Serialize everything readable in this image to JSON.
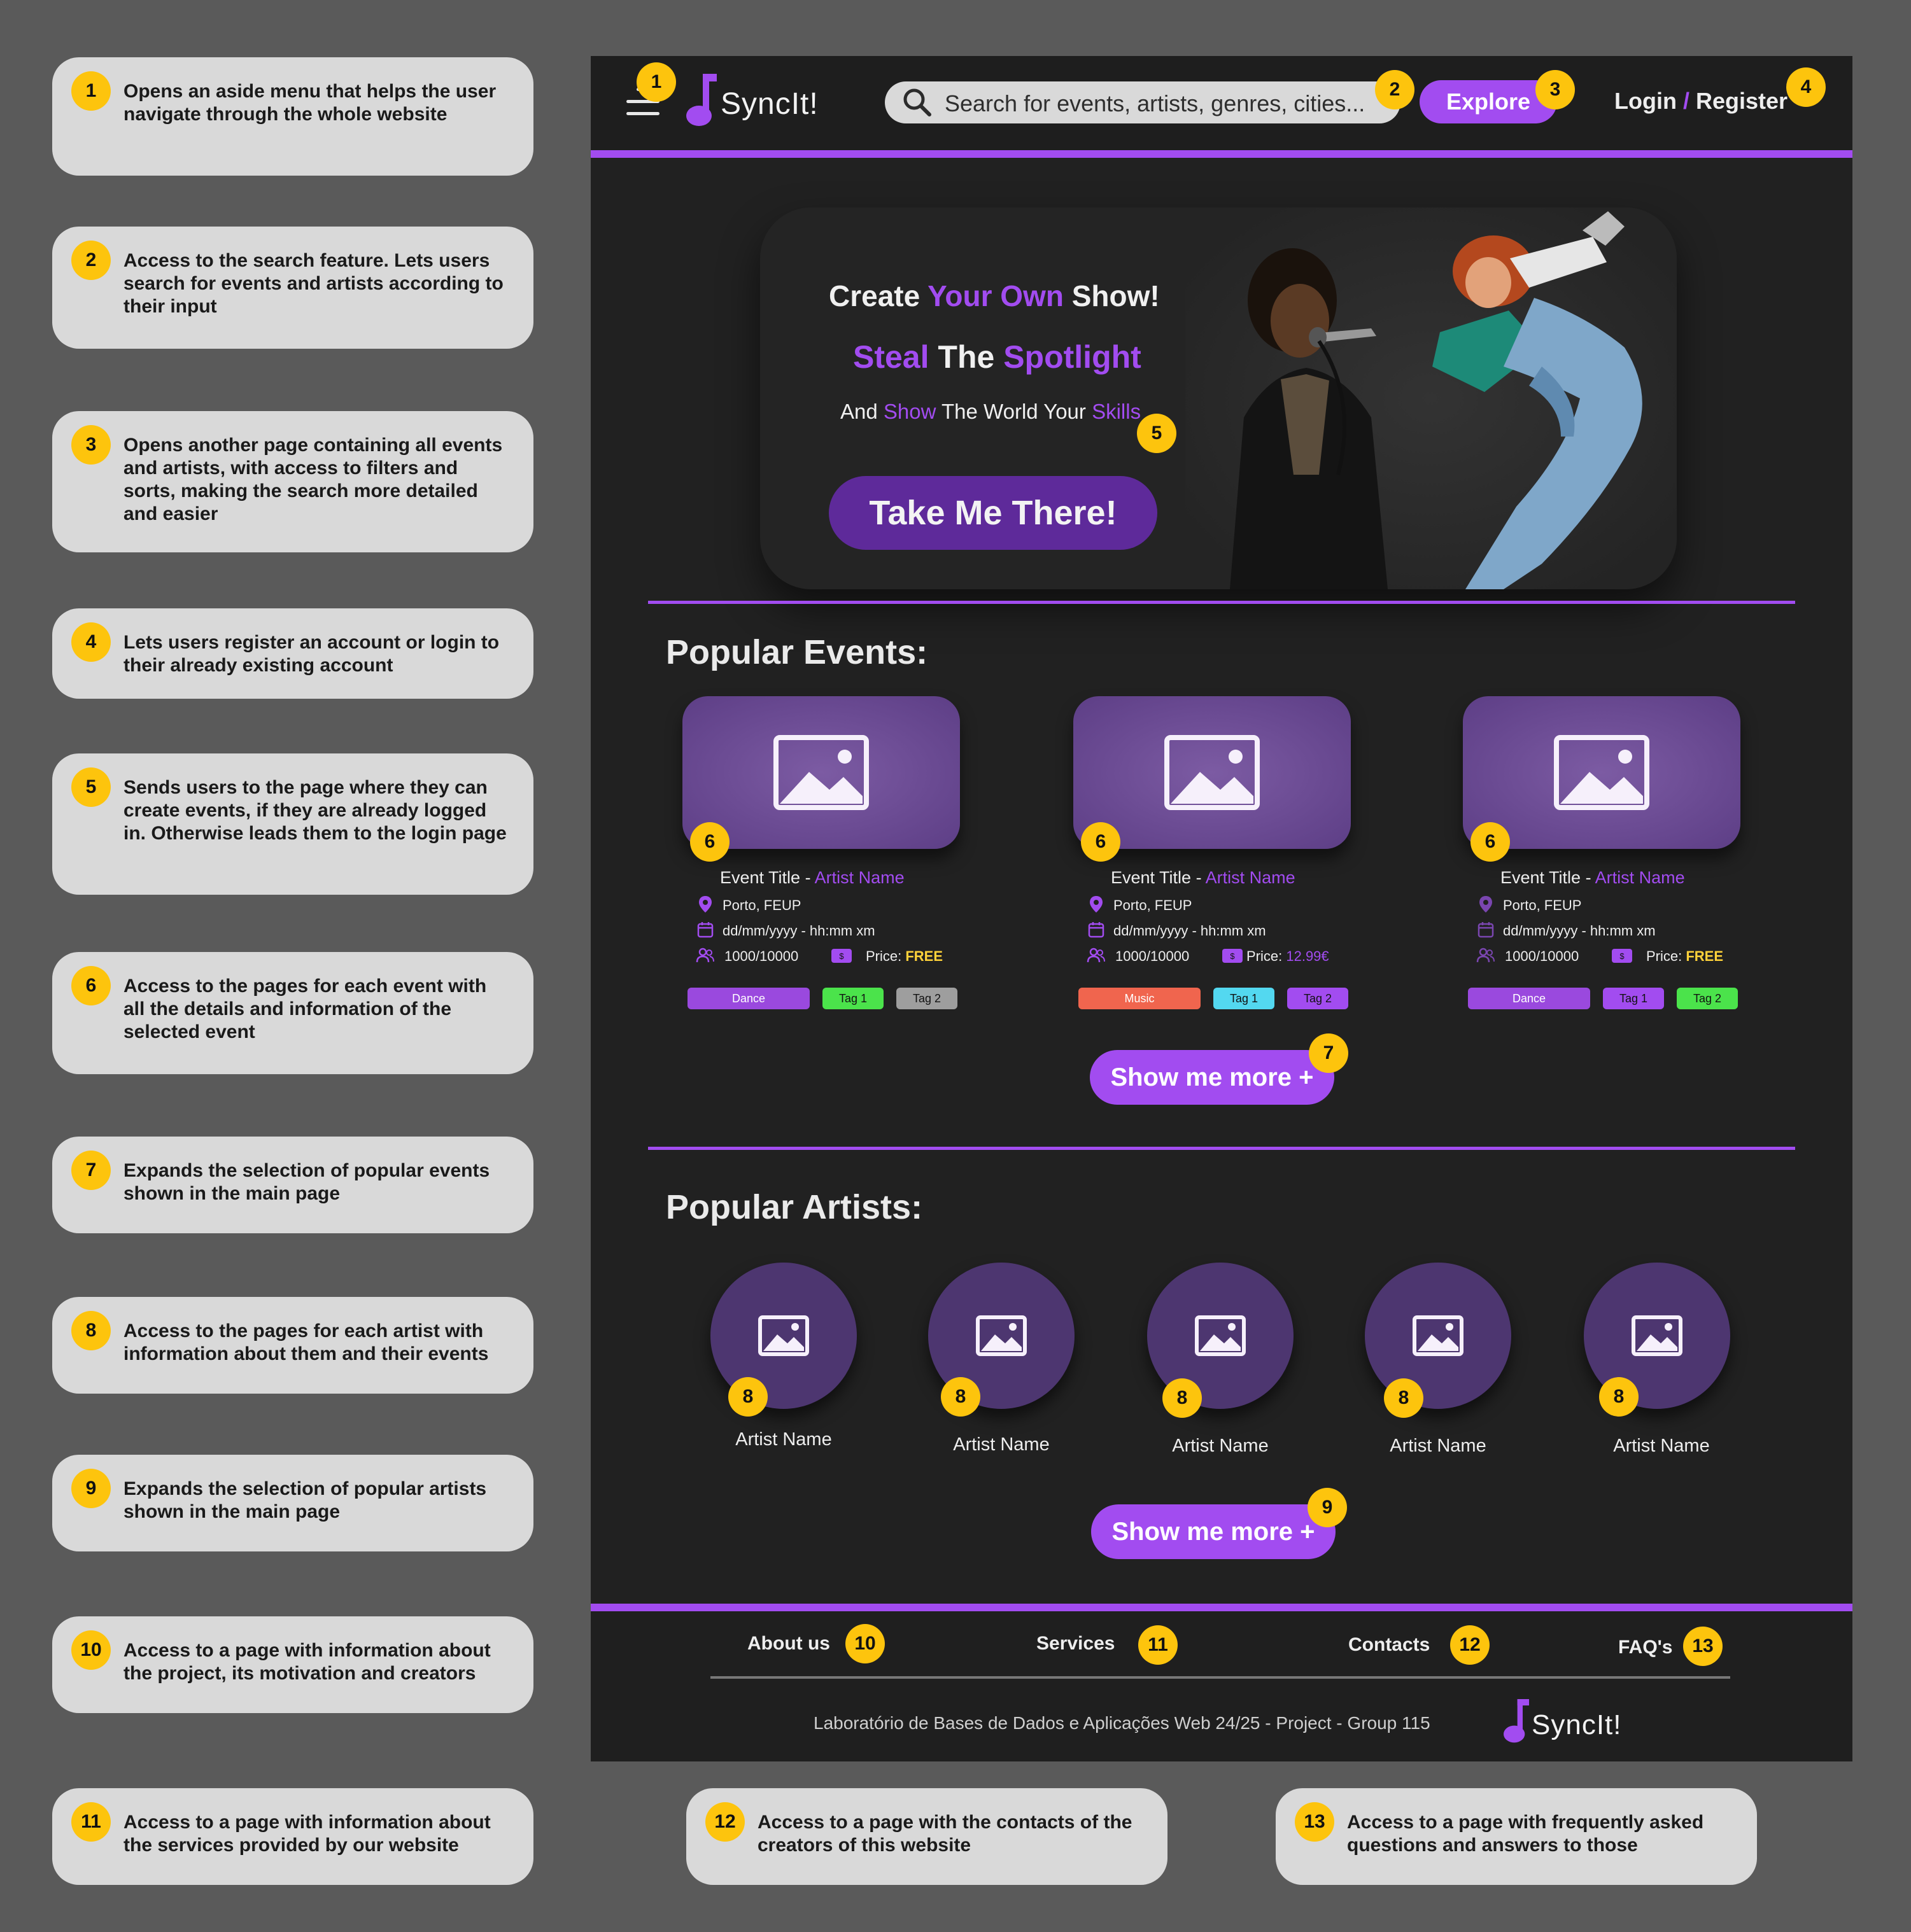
{
  "annotations": [
    {
      "n": "1",
      "text": "Opens an aside menu that helps the user navigate through the whole website"
    },
    {
      "n": "2",
      "text": "Access to the search feature.  Lets users search for events and artists according to their input"
    },
    {
      "n": "3",
      "text": "Opens another page containing all events and artists, with access to filters and sorts, making the search more detailed and easier"
    },
    {
      "n": "4",
      "text": "Lets users register an account or login to their already existing account"
    },
    {
      "n": "5",
      "text": "Sends users to the page where they can create events, if they are already logged in. Otherwise leads them to the login page"
    },
    {
      "n": "6",
      "text": "Access to the pages for each event with all the details and information of the selected event"
    },
    {
      "n": "7",
      "text": "Expands the selection of popular events shown in the main page"
    },
    {
      "n": "8",
      "text": "Access to the pages for each artist with information about them and their events"
    },
    {
      "n": "9",
      "text": "Expands the selection of popular artists shown in the main page"
    },
    {
      "n": "10",
      "text": "Access to a page with information about the project, its motivation and creators"
    },
    {
      "n": "11",
      "text": "Access to a page with information about the services provided by our website"
    },
    {
      "n": "12",
      "text": "Access to a page with the contacts of the creators of this website"
    },
    {
      "n": "13",
      "text": "Access to a page with frequently asked questions and answers to those"
    }
  ],
  "colors": {
    "accent": "#a24cf0",
    "badge": "#fdc40d",
    "bg": "#212121",
    "canvas": "#5a5a5a"
  },
  "header": {
    "menu_icon": "hamburger-icon",
    "logo_icon": "music-note-icon",
    "logo": "SyncIt!",
    "search_icon": "search-icon",
    "search_placeholder": "Search for events, artists, genres, cities...",
    "explore": "Explore",
    "login": "Login",
    "slash": "/",
    "register": "Register"
  },
  "hero": {
    "line1": {
      "a": "Create ",
      "b": "Your Own",
      "c": " Show!"
    },
    "line2": {
      "a": "Steal",
      "b": " The ",
      "c": "Spotlight"
    },
    "line3": {
      "a": "And ",
      "b": "Show",
      "c": " The World Your ",
      "d": "Skills"
    },
    "button": "Take Me There!"
  },
  "events": {
    "title": "Popular Events:",
    "items": [
      {
        "title": "Event Title",
        "sep": " - ",
        "artist": "Artist Name",
        "location": "Porto, FEUP",
        "date": "dd/mm/yyyy - hh:mm xm",
        "capacity": "1000/10000",
        "price_label": "Price: ",
        "price": "FREE",
        "tags": [
          {
            "label": "Dance",
            "color": "#9a49de"
          },
          {
            "label": "Tag 1",
            "color": "#4be34b"
          },
          {
            "label": "Tag 2",
            "color": "#9e9e9e"
          }
        ]
      },
      {
        "title": "Event Title",
        "sep": " - ",
        "artist": "Artist Name",
        "location": "Porto, FEUP",
        "date": "dd/mm/yyyy - hh:mm xm",
        "capacity": "1000/10000",
        "price_label": "Price: ",
        "price": "12.99€",
        "tags": [
          {
            "label": "Music",
            "color": "#f0654e"
          },
          {
            "label": "Tag 1",
            "color": "#53d8f0"
          },
          {
            "label": "Tag 2",
            "color": "#a24cf0"
          }
        ]
      },
      {
        "title": "Event Title",
        "sep": " - ",
        "artist": "Artist Name",
        "location": "Porto, FEUP",
        "date": "dd/mm/yyyy - hh:mm xm",
        "capacity": "1000/10000",
        "price_label": "Price: ",
        "price": "FREE",
        "tags": [
          {
            "label": "Dance",
            "color": "#9a49de"
          },
          {
            "label": "Tag 1",
            "color": "#a24cf0"
          },
          {
            "label": "Tag 2",
            "color": "#4be34b"
          }
        ]
      }
    ],
    "more": "Show me more +"
  },
  "artists": {
    "title": "Popular Artists:",
    "items": [
      {
        "name": "Artist Name"
      },
      {
        "name": "Artist Name"
      },
      {
        "name": "Artist Name"
      },
      {
        "name": "Artist Name"
      },
      {
        "name": "Artist Name"
      }
    ],
    "more": "Show me more +"
  },
  "footer": {
    "links": [
      "About us",
      "Services",
      "Contacts",
      "FAQ's"
    ],
    "copyright": "Laboratório de Bases de Dados e Aplicações Web  24/25 - Project - Group 115",
    "logo": "SyncIt!"
  }
}
